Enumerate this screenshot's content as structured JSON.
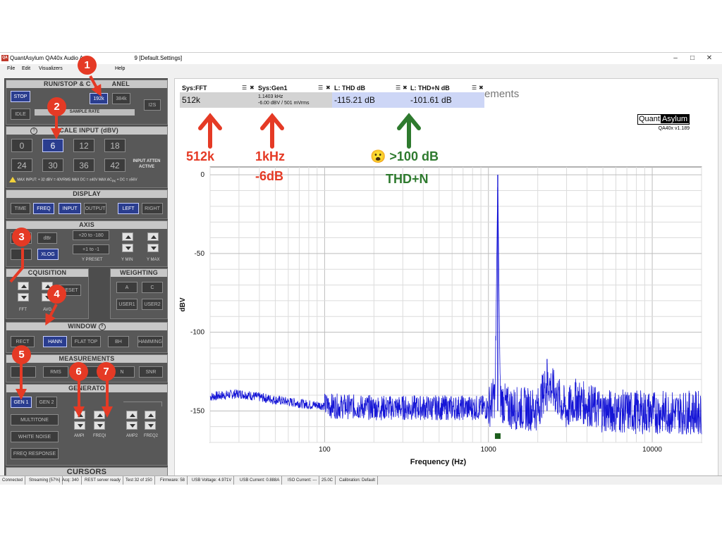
{
  "window": {
    "title": "QuantAsylum QA40x Audio An",
    "title_tail": "9 [Default.Settings]",
    "app_icon": "QA",
    "controls": [
      "–",
      "□",
      "✕"
    ]
  },
  "menu": [
    "File",
    "Edit",
    "Visualizers",
    "Help"
  ],
  "panel": {
    "run": {
      "header": "RUN/STOP & C",
      "header_tail": "ANEL",
      "stop": "STOP",
      "idle": "IDLE",
      "rates": [
        "192k",
        "384k"
      ],
      "i2s": "I2S",
      "sample_rate": "SAMPLE RATE"
    },
    "scale": {
      "header": "SCALE INPUT (dBV)",
      "values": [
        "0",
        "6",
        "12",
        "18",
        "24",
        "30",
        "36",
        "42"
      ],
      "atten": "INPUT ATTEN ACTIVE",
      "warn": "MAX INPUT: + 32 dBV = 40VRMS    MAX DC = ±40V    MAX AC",
      "warn_sub": "PK",
      "warn_tail": " + DC = ±56V"
    },
    "display": {
      "header": "DISPLAY",
      "buttons": [
        "TIME",
        "FREQ",
        "INPUT",
        "OUTPUT",
        "LEFT",
        "RIGHT"
      ]
    },
    "axis": {
      "header": "AXIS",
      "dbr": "dBr",
      "xlog": "XLOG",
      "preset1": "+20 to -180",
      "preset2": "+1 to -1",
      "ypreset": "Y PRESET",
      "ymin": "Y MIN",
      "ymax": "Y MAX"
    },
    "acquisition": {
      "header": "CQUISITION",
      "reset": "RESET",
      "fft": "FFT",
      "avg": "AVG"
    },
    "weighting": {
      "header": "WEIGHTING",
      "buttons": [
        "A",
        "C",
        "USER1",
        "USER2"
      ]
    },
    "window": {
      "header": "WINDOW",
      "buttons": [
        "RECT",
        "HANN",
        "FLAT TOP",
        "BH",
        "HAMMING"
      ]
    },
    "measurements": {
      "header": "MEASUREMENTS",
      "buttons": [
        "",
        "RMS",
        "N",
        "SNR"
      ]
    },
    "generators": {
      "header": "GENERATO",
      "gen1": "GEN 1",
      "gen2": "GEN 2",
      "multitone": "MULTITONE",
      "whitenoise": "WHITE NOISE",
      "freqresp": "FREQ RESPONSE",
      "labels": [
        "AMPl",
        "FREQl",
        "AMP2",
        "FREQ2"
      ]
    },
    "cursors": {
      "header": "CURSORS"
    }
  },
  "measurement_boxes": [
    {
      "title": "Sys:FFT",
      "value": "512k",
      "color": "#d3d3d3"
    },
    {
      "title": "Sys:Gen1",
      "value": "1.1403 kHz",
      "value2": "-6.00 dBV / 501 mVrms",
      "color": "#d3d3d3"
    },
    {
      "title": "L: THD dB",
      "value": "-115.21 dB",
      "color": "#cdd6f6"
    },
    {
      "title": "L: THD+N dB",
      "value": "-101.61 dB",
      "color": "#cdd6f6"
    }
  ],
  "behind_title": "ements",
  "brand": {
    "quant": "Quant",
    "asylum": "Asylum",
    "version": "QA40x v1.189"
  },
  "chart_data": {
    "type": "line",
    "xlabel": "Frequency (Hz)",
    "ylabel": "dBV",
    "x_scale": "log",
    "xlim": [
      20,
      20000
    ],
    "ylim": [
      -170,
      5
    ],
    "xticks": [
      "100",
      "1000",
      "10000"
    ],
    "yticks": [
      "0",
      "-50",
      "-100",
      "-150"
    ],
    "grid": true,
    "color": "#1515d6",
    "series": [
      {
        "x": [
          20,
          30,
          50,
          80,
          120,
          200,
          400,
          700,
          1000,
          1100,
          1140,
          1180,
          1300,
          2000,
          2280,
          3000,
          3420,
          5000,
          10000,
          20000
        ],
        "y": [
          -141,
          -139,
          -143,
          -146,
          -147,
          -148,
          -148,
          -148,
          -148,
          -140,
          0,
          -142,
          -148,
          -149,
          -131,
          -150,
          -143,
          -150,
          -151,
          -151
        ]
      }
    ],
    "marker": {
      "x": 1140,
      "y": -166,
      "color": "#1d5e1d"
    }
  },
  "annotations": {
    "badges": [
      "1",
      "2",
      "3",
      "4",
      "5",
      "6",
      "7"
    ],
    "fft": "512k",
    "gen1": "1kHz",
    "gen2": "-6dB",
    "thd1": "😮 >100 dB",
    "thd2": "THD+N"
  },
  "statusbar": [
    "Connected",
    "Streaming [57%]",
    "Acq: 340",
    "REST server ready",
    "Test 32 of 150",
    "Firmware: 58",
    "USB Voltage: 4.971V",
    "USB Current: 0.888A",
    "ISO Current: ---",
    "25.0C",
    "Calibration: Default"
  ]
}
